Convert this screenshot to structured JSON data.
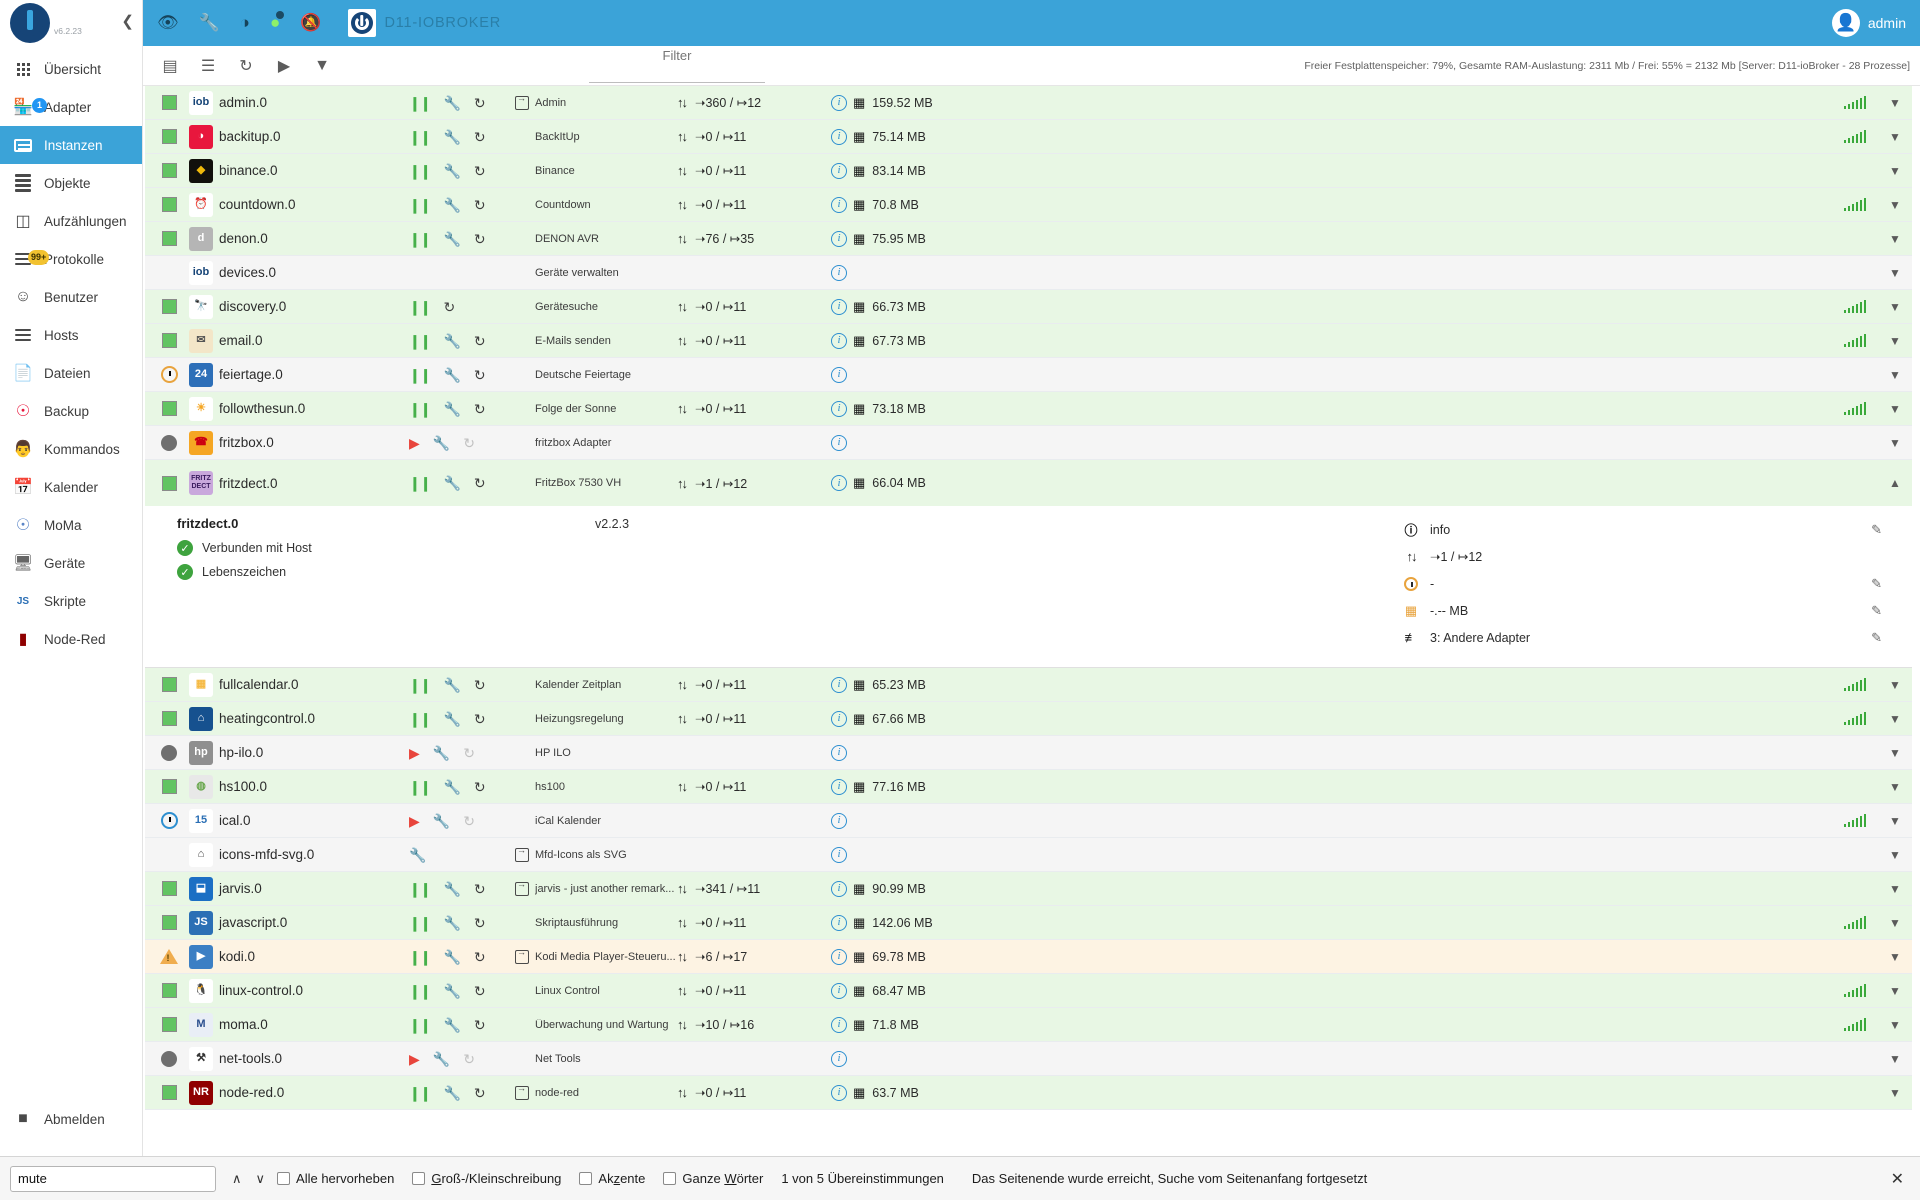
{
  "sidebar": {
    "version": "v6.2.23",
    "collapse_icon": "chevron-left-icon",
    "items": [
      {
        "label": "Übersicht",
        "icon": "grid-icon",
        "active": false,
        "badge": null
      },
      {
        "label": "Adapter",
        "icon": "store-icon",
        "active": false,
        "badge": "1"
      },
      {
        "label": "Instanzen",
        "icon": "instances-icon",
        "active": true,
        "badge": null
      },
      {
        "label": "Objekte",
        "icon": "list-icon",
        "active": false,
        "badge": null
      },
      {
        "label": "Aufzählungen",
        "icon": "enum-icon",
        "active": false,
        "badge": null
      },
      {
        "label": "Protokolle",
        "icon": "logs-icon",
        "active": false,
        "badge": "99+"
      },
      {
        "label": "Benutzer",
        "icon": "user-icon",
        "active": false,
        "badge": null
      },
      {
        "label": "Hosts",
        "icon": "server-icon",
        "active": false,
        "badge": null
      },
      {
        "label": "Dateien",
        "icon": "files-icon",
        "active": false,
        "badge": null
      },
      {
        "label": "Backup",
        "icon": "backup-icon",
        "active": false,
        "badge": null
      },
      {
        "label": "Kommandos",
        "icon": "commands-icon",
        "active": false,
        "badge": null
      },
      {
        "label": "Kalender",
        "icon": "calendar-icon",
        "active": false,
        "badge": null
      },
      {
        "label": "MoMa",
        "icon": "moma-icon",
        "active": false,
        "badge": null
      },
      {
        "label": "Geräte",
        "icon": "devices-icon",
        "active": false,
        "badge": null
      },
      {
        "label": "Skripte",
        "icon": "script-icon",
        "active": false,
        "badge": null
      },
      {
        "label": "Node-Red",
        "icon": "nodered-icon",
        "active": false,
        "badge": null
      }
    ],
    "logout": {
      "label": "Abmelden",
      "icon": "logout-icon"
    }
  },
  "appbar": {
    "icons": [
      "eye-icon",
      "wrench-icon",
      "contrast-icon",
      "head-icon",
      "bell-off-icon"
    ],
    "title": "D11-IOBROKER",
    "user": "admin",
    "avatar_icon": "avatar-icon"
  },
  "toolbar": {
    "buttons": [
      "table-view-icon",
      "list-view-icon",
      "refresh-icon",
      "play-all-icon",
      "filter-icon"
    ],
    "filter_label": "Filter",
    "filter_value": "",
    "filter_placeholder": "",
    "status": "Freier Festplattenspeicher: 79%, Gesamte RAM-Auslastung: 2311 Mb / Frei: 55% = 2132 Mb [Server: D11-ioBroker - 28 Prozesse]"
  },
  "table": {
    "rows": [
      {
        "state": "square-on",
        "icon_label": "iob",
        "icon_bg": "#ffffff",
        "icon_color": "#164477",
        "name": "admin.0",
        "controls": [
          "pause",
          "wrench",
          "refresh"
        ],
        "link": true,
        "title": "Admin",
        "io": "➝360 / ↦12",
        "info": true,
        "mem": "159.52 MB",
        "signal": true,
        "rowclass": "run"
      },
      {
        "state": "square-on",
        "icon_label": "◑",
        "icon_bg": "#e8173d",
        "icon_color": "#ffffff",
        "name": "backitup.0",
        "controls": [
          "pause",
          "wrench",
          "refresh"
        ],
        "link": false,
        "title": "BackItUp",
        "io": "➝0 / ↦11",
        "info": true,
        "mem": "75.14 MB",
        "signal": true,
        "rowclass": "run"
      },
      {
        "state": "square-on",
        "icon_label": "◆",
        "icon_bg": "#12100c",
        "icon_color": "#f0b90b",
        "name": "binance.0",
        "controls": [
          "pause",
          "wrench",
          "refresh"
        ],
        "link": false,
        "title": "Binance",
        "io": "➝0 / ↦11",
        "info": true,
        "mem": "83.14 MB",
        "signal": false,
        "rowclass": "run"
      },
      {
        "state": "square-on",
        "icon_label": "⏰",
        "icon_bg": "#ffffff",
        "icon_color": "#111111",
        "name": "countdown.0",
        "controls": [
          "pause",
          "wrench",
          "refresh"
        ],
        "link": false,
        "title": "Countdown",
        "io": "➝0 / ↦11",
        "info": true,
        "mem": "70.8 MB",
        "signal": true,
        "rowclass": "run"
      },
      {
        "state": "square-on",
        "icon_label": "d",
        "icon_bg": "#b5b5b5",
        "icon_color": "#ffffff",
        "name": "denon.0",
        "controls": [
          "pause",
          "wrench",
          "refresh"
        ],
        "link": false,
        "title": "DENON AVR",
        "io": "➝76 / ↦35",
        "info": true,
        "mem": "75.95 MB",
        "signal": false,
        "rowclass": "run"
      },
      {
        "state": "none",
        "icon_label": "iob",
        "icon_bg": "#ffffff",
        "icon_color": "#164477",
        "name": "devices.0",
        "controls": [],
        "link": false,
        "title": "Geräte verwalten",
        "io": "",
        "info": true,
        "mem": "",
        "signal": false,
        "rowclass": "stop"
      },
      {
        "state": "square-on",
        "icon_label": "🔭",
        "icon_bg": "#ffffff",
        "icon_color": "#333",
        "name": "discovery.0",
        "controls": [
          "pause",
          "refresh"
        ],
        "link": false,
        "title": "Gerätesuche",
        "io": "➝0 / ↦11",
        "info": true,
        "mem": "66.73 MB",
        "signal": true,
        "rowclass": "run"
      },
      {
        "state": "square-on",
        "icon_label": "✉",
        "icon_bg": "#f3e6c8",
        "icon_color": "#555",
        "name": "email.0",
        "controls": [
          "pause",
          "wrench",
          "refresh"
        ],
        "link": false,
        "title": "E-Mails senden",
        "io": "➝0 / ↦11",
        "info": true,
        "mem": "67.73 MB",
        "signal": true,
        "rowclass": "run"
      },
      {
        "state": "clock",
        "icon_label": "24",
        "icon_bg": "#2d6fb8",
        "icon_color": "#ffffff",
        "name": "feiertage.0",
        "controls": [
          "pause",
          "wrench",
          "refresh"
        ],
        "link": false,
        "title": "Deutsche Feiertage",
        "io": "",
        "info": true,
        "mem": "",
        "signal": false,
        "rowclass": "stop"
      },
      {
        "state": "square-on",
        "icon_label": "☀",
        "icon_bg": "#ffffff",
        "icon_color": "#f5a623",
        "name": "followthesun.0",
        "controls": [
          "pause",
          "wrench",
          "refresh"
        ],
        "link": false,
        "title": "Folge der Sonne",
        "io": "➝0 / ↦11",
        "info": true,
        "mem": "73.18 MB",
        "signal": true,
        "rowclass": "run"
      },
      {
        "state": "circle",
        "icon_label": "☎",
        "icon_bg": "#f5a623",
        "icon_color": "#c01",
        "name": "fritzbox.0",
        "controls": [
          "play",
          "wrench",
          "refresh-dim"
        ],
        "link": false,
        "title": "fritzbox Adapter",
        "io": "",
        "info": true,
        "mem": "",
        "signal": false,
        "rowclass": "stop"
      }
    ],
    "expanded": {
      "state": "square-on",
      "icon_label": "FRITZ DECT",
      "icon_bg": "#c9a8dc",
      "icon_color": "#3a1b5e",
      "name": "fritzdect.0",
      "controls": [
        "pause",
        "wrench",
        "refresh"
      ],
      "title": "FritzBox 7530 VH",
      "io": "➝1 / ↦12",
      "mem": "66.04 MB",
      "rowclass": "run",
      "detail": {
        "id": "fritzdect.0",
        "version": "v2.2.3",
        "status_lines": [
          {
            "icon": "check-circle-icon",
            "label": "Verbunden mit Host"
          },
          {
            "icon": "check-circle-icon",
            "label": "Lebenszeichen"
          }
        ],
        "right_rows": [
          {
            "icon": "info-bold-icon",
            "value": "info",
            "editable": true
          },
          {
            "icon": "io-arrows-icon",
            "value": "➝1 / ↦12",
            "editable": false
          },
          {
            "icon": "clock-icon",
            "value": "-",
            "editable": true
          },
          {
            "icon": "cpu-icon",
            "value": "-.-- MB",
            "editable": true
          },
          {
            "icon": "loglevel-icon",
            "value": "3: Andere Adapter",
            "editable": true
          }
        ],
        "delete_icon": "trash-icon"
      }
    },
    "rows_after": [
      {
        "state": "square-on",
        "icon_label": "▦",
        "icon_bg": "#ffffff",
        "icon_color": "#f5b942",
        "name": "fullcalendar.0",
        "controls": [
          "pause",
          "wrench",
          "refresh"
        ],
        "link": false,
        "title": "Kalender Zeitplan",
        "io": "➝0 / ↦11",
        "info": true,
        "mem": "65.23 MB",
        "signal": true,
        "rowclass": "run"
      },
      {
        "state": "square-on",
        "icon_label": "⌂",
        "icon_bg": "#16518f",
        "icon_color": "#ffffff",
        "name": "heatingcontrol.0",
        "controls": [
          "pause",
          "wrench",
          "refresh"
        ],
        "link": false,
        "title": "Heizungsregelung",
        "io": "➝0 / ↦11",
        "info": true,
        "mem": "67.66 MB",
        "signal": true,
        "rowclass": "run"
      },
      {
        "state": "circle",
        "icon_label": "hp",
        "icon_bg": "#8f8f8f",
        "icon_color": "#ffffff",
        "name": "hp-ilo.0",
        "controls": [
          "play",
          "wrench",
          "refresh-dim"
        ],
        "link": false,
        "title": "HP ILO",
        "io": "",
        "info": true,
        "mem": "",
        "signal": false,
        "rowclass": "stop"
      },
      {
        "state": "square-on",
        "icon_label": "◍",
        "icon_bg": "#e8e8e8",
        "icon_color": "#6aa84f",
        "name": "hs100.0",
        "controls": [
          "pause",
          "wrench",
          "refresh"
        ],
        "link": false,
        "title": "hs100",
        "io": "➝0 / ↦11",
        "info": true,
        "mem": "77.16 MB",
        "signal": false,
        "rowclass": "run"
      },
      {
        "state": "clock-blue",
        "icon_label": "15",
        "icon_bg": "#ffffff",
        "icon_color": "#2b6fb5",
        "name": "ical.0",
        "controls": [
          "play",
          "wrench",
          "refresh-dim"
        ],
        "link": false,
        "title": "iCal Kalender",
        "io": "",
        "info": true,
        "mem": "",
        "signal": true,
        "rowclass": "stop"
      },
      {
        "state": "none",
        "icon_label": "⌂",
        "icon_bg": "#ffffff",
        "icon_color": "#444",
        "name": "icons-mfd-svg.0",
        "controls": [
          "wrench"
        ],
        "link": true,
        "title": "Mfd-Icons als SVG",
        "io": "",
        "info": true,
        "mem": "",
        "signal": false,
        "rowclass": "stop"
      },
      {
        "state": "square-on",
        "icon_label": "⬓",
        "icon_bg": "#1b6fc4",
        "icon_color": "#ffffff",
        "name": "jarvis.0",
        "controls": [
          "pause",
          "wrench",
          "refresh"
        ],
        "link": true,
        "title": "jarvis - just another remark...",
        "io": "➝341 / ↦11",
        "info": true,
        "mem": "90.99 MB",
        "signal": false,
        "rowclass": "run"
      },
      {
        "state": "square-on",
        "icon_label": "JS",
        "icon_bg": "#2b6fb5",
        "icon_color": "#ffffff",
        "name": "javascript.0",
        "controls": [
          "pause",
          "wrench",
          "refresh"
        ],
        "link": false,
        "title": "Skriptausführung",
        "io": "➝0 / ↦11",
        "info": true,
        "mem": "142.06 MB",
        "signal": true,
        "rowclass": "run"
      },
      {
        "state": "warn",
        "icon_label": "▶",
        "icon_bg": "#3c7fc4",
        "icon_color": "#ffffff",
        "name": "kodi.0",
        "controls": [
          "pause",
          "wrench",
          "refresh"
        ],
        "link": true,
        "title": "Kodi Media Player-Steueru...",
        "io": "➝6 / ↦17",
        "info": true,
        "mem": "69.78 MB",
        "signal": false,
        "rowclass": "warn-row"
      },
      {
        "state": "square-on",
        "icon_label": "🐧",
        "icon_bg": "#ffffff",
        "icon_color": "#111",
        "name": "linux-control.0",
        "controls": [
          "pause",
          "wrench",
          "refresh"
        ],
        "link": false,
        "title": "Linux Control",
        "io": "➝0 / ↦11",
        "info": true,
        "mem": "68.47 MB",
        "signal": true,
        "rowclass": "run"
      },
      {
        "state": "square-on",
        "icon_label": "M",
        "icon_bg": "#e9eef6",
        "icon_color": "#2b4f8e",
        "name": "moma.0",
        "controls": [
          "pause",
          "wrench",
          "refresh"
        ],
        "link": false,
        "title": "Überwachung und Wartung",
        "io": "➝10 / ↦16",
        "info": true,
        "mem": "71.8 MB",
        "signal": true,
        "rowclass": "run"
      },
      {
        "state": "circle",
        "icon_label": "⚒",
        "icon_bg": "#ffffff",
        "icon_color": "#333",
        "name": "net-tools.0",
        "controls": [
          "play",
          "wrench",
          "refresh-dim"
        ],
        "link": false,
        "title": "Net Tools",
        "io": "",
        "info": true,
        "mem": "",
        "signal": false,
        "rowclass": "stop"
      },
      {
        "state": "square-on",
        "icon_label": "NR",
        "icon_bg": "#8f0000",
        "icon_color": "#ffffff",
        "name": "node-red.0",
        "controls": [
          "pause",
          "wrench",
          "refresh"
        ],
        "link": true,
        "title": "node-red",
        "io": "➝0 / ↦11",
        "info": true,
        "mem": "63.7 MB",
        "signal": false,
        "rowclass": "run"
      }
    ]
  },
  "findbar": {
    "query": "mute",
    "prev_icon": "chevron-up-icon",
    "next_icon": "chevron-down-icon",
    "options": [
      {
        "label": "Alle hervorheben",
        "underline": "",
        "checked": false
      },
      {
        "label": "Groß-/Kleinschreibung",
        "underline": "G",
        "checked": false
      },
      {
        "label": "Akzente",
        "underline": "z",
        "checked": false
      },
      {
        "label": "Ganze Wörter",
        "underline": "W",
        "checked": false
      }
    ],
    "count": "1 von 5 Übereinstimmungen",
    "message": "Das Seitenende wurde erreicht, Suche vom Seitenanfang fortgesetzt",
    "close_icon": "close-icon"
  },
  "colors": {
    "accent": "#3ba3d8",
    "running_row": "#e8f7e4",
    "stopped_row": "#f5f5f5",
    "warn_row": "#fdf3e3",
    "green": "#46b04a",
    "red": "#e8453c"
  }
}
